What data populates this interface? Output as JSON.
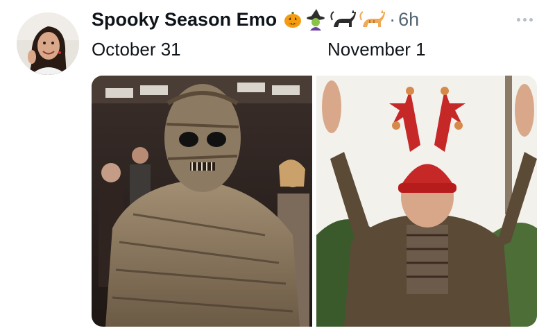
{
  "tweet": {
    "display_name": "Spooky Season Emo",
    "timestamp": "6h",
    "separator": "·",
    "emoji_badges": [
      "🎃",
      "🧙",
      "🐈‍⬛",
      "🐈"
    ],
    "captions": {
      "left": "October 31",
      "right": "November 1"
    }
  },
  "icons": {
    "more": "more-options-icon",
    "avatar": "profile-avatar"
  },
  "colors": {
    "name_text": "#0f1419",
    "secondary_text": "#536471",
    "more_dots": "#b6bfc6"
  }
}
